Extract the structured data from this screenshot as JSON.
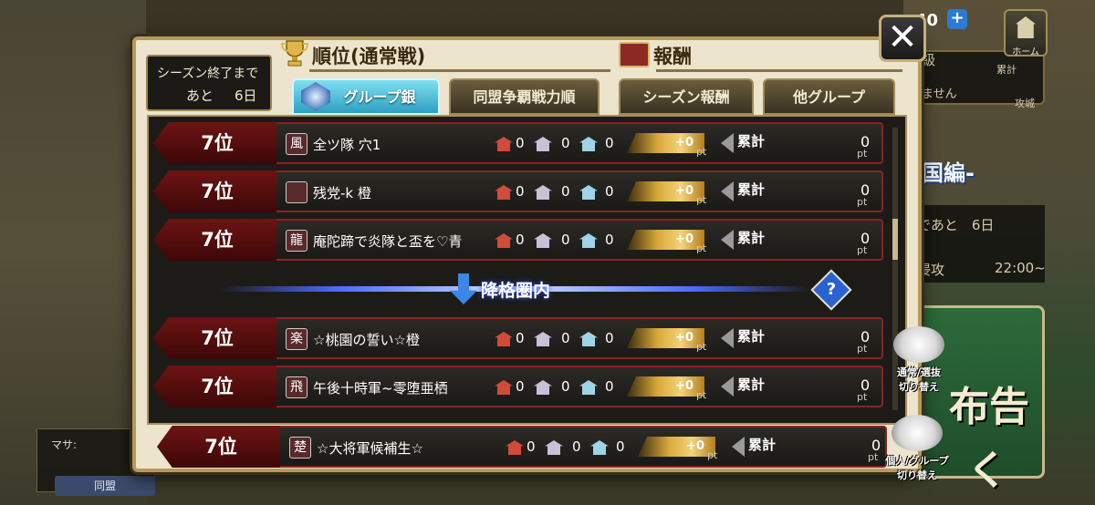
{
  "hud": {
    "counter": "40",
    "plus": "+",
    "home_label": "ホーム"
  },
  "background": {
    "right_text_1": "級",
    "right_text_2": "ません",
    "right_text_3": "累計",
    "right_text_4": "攻城",
    "right_text_5": "国編-",
    "right_text_6": "であと　6日",
    "right_text_7": "侵攻",
    "right_text_8": "22:00~",
    "right_big_1": "布告",
    "right_big_2": "く",
    "left_panel_label": "マサ:",
    "left_button": "同盟"
  },
  "dialog": {
    "season": {
      "line1": "シーズン終了まで",
      "line2": "あと",
      "days": "6日"
    },
    "ranking_title": "順位(通常戦)",
    "reward_title": "報酬",
    "tabs": [
      {
        "label": "グループ銀",
        "active": true
      },
      {
        "label": "同盟争覇戦力順",
        "active": false
      },
      {
        "label": "シーズン報酬",
        "active": false
      },
      {
        "label": "他グループ",
        "active": false
      }
    ],
    "close_label": "✕",
    "demotion_label": "降格圏内",
    "help_label": "?"
  },
  "rows": [
    {
      "rank": "7位",
      "emblem": "風",
      "name": "全ツ隊 穴1",
      "c1": "0",
      "c2": "0",
      "c3": "0",
      "pt": "+0",
      "pt_unit": "pt",
      "total_label": "累計",
      "total": "0",
      "total_unit": "pt"
    },
    {
      "rank": "7位",
      "emblem": "",
      "name": "残党-k 橙",
      "c1": "0",
      "c2": "0",
      "c3": "0",
      "pt": "+0",
      "pt_unit": "pt",
      "total_label": "累計",
      "total": "0",
      "total_unit": "pt"
    },
    {
      "rank": "7位",
      "emblem": "龍",
      "name": "庵陀蹄で炎隊と盃を♡青",
      "c1": "0",
      "c2": "0",
      "c3": "0",
      "pt": "+0",
      "pt_unit": "pt",
      "total_label": "累計",
      "total": "0",
      "total_unit": "pt"
    },
    {
      "rank": "7位",
      "emblem": "楽",
      "name": "☆桃園の誓い☆橙",
      "c1": "0",
      "c2": "0",
      "c3": "0",
      "pt": "+0",
      "pt_unit": "pt",
      "total_label": "累計",
      "total": "0",
      "total_unit": "pt"
    },
    {
      "rank": "7位",
      "emblem": "飛",
      "name": "午後十時軍~零堕亜栖",
      "c1": "0",
      "c2": "0",
      "c3": "0",
      "pt": "+0",
      "pt_unit": "pt",
      "total_label": "累計",
      "total": "0",
      "total_unit": "pt"
    }
  ],
  "own_row": {
    "rank": "7位",
    "emblem": "楚",
    "name": "☆大将軍候補生☆",
    "c1": "0",
    "c2": "0",
    "c3": "0",
    "pt": "+0",
    "pt_unit": "pt",
    "total_label": "累計",
    "total": "0",
    "total_unit": "pt"
  },
  "side_buttons": {
    "toggle_mode": "通常/選抜\n切り替え",
    "toggle_mode_l1": "通常/選抜",
    "toggle_mode_l2": "切り替え",
    "toggle_group_l1": "個人/グループ",
    "toggle_group_l2": "切り替え"
  },
  "colors": {
    "rank_red": "#6e1414",
    "tab_active": "#2e9fc2",
    "pt_gold": "#d9a93a",
    "demotion_blue": "#4a6bff"
  }
}
